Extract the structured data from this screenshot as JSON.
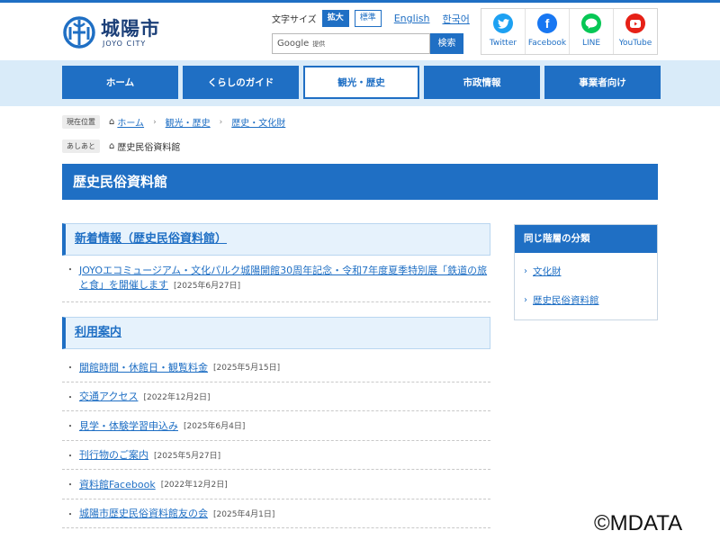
{
  "header": {
    "logo_name": "城陽市",
    "logo_sub": "JOYO CITY",
    "fontsize_label": "文字サイズ",
    "fontsize_large": "拡大",
    "fontsize_normal": "標準",
    "lang_english": "English",
    "lang_korean": "한국어",
    "search_google": "Google",
    "search_provided": "提供",
    "search_button": "検索"
  },
  "social": [
    {
      "label": "Twitter",
      "icon": "twitter-icon",
      "color": "#1da1f2"
    },
    {
      "label": "Facebook",
      "icon": "facebook-icon",
      "color": "#1877f2"
    },
    {
      "label": "LINE",
      "icon": "line-icon",
      "color": "#06c755"
    },
    {
      "label": "YouTube",
      "icon": "youtube-icon",
      "color": "#e62117"
    }
  ],
  "nav": [
    {
      "label": "ホーム"
    },
    {
      "label": "くらしのガイド"
    },
    {
      "label": "観光・歴史"
    },
    {
      "label": "市政情報"
    },
    {
      "label": "事業者向け"
    }
  ],
  "breadcrumb": {
    "current_tag": "現在位置",
    "home": "ホーム",
    "level1": "観光・歴史",
    "level2": "歴史・文化財",
    "footprints_tag": "あしあと",
    "footprint": "歴史民俗資料館"
  },
  "page_title": "歴史民俗資料館",
  "news": {
    "heading": "新着情報（歴史民俗資料館）",
    "items": [
      {
        "title": "JOYOエコミュージアム・文化パルク城陽開館30周年記念・令和7年度夏季特別展「鉄道の旅と食」を開催します",
        "date": "[2025年6月27日]"
      }
    ]
  },
  "guide": {
    "heading": "利用案内",
    "items": [
      {
        "title": "開館時間・休館日・観覧料金",
        "date": "[2025年5月15日]"
      },
      {
        "title": "交通アクセス",
        "date": "[2022年12月2日]"
      },
      {
        "title": "見学・体験学習申込み",
        "date": "[2025年6月4日]"
      },
      {
        "title": "刊行物のご案内",
        "date": "[2025年5月27日]"
      },
      {
        "title": "資料館Facebook",
        "date": "[2022年12月2日]"
      },
      {
        "title": "城陽市歴史民俗資料館友の会",
        "date": "[2025年4月1日]"
      }
    ]
  },
  "sidebar": {
    "heading": "同じ階層の分類",
    "items": [
      {
        "label": "文化財"
      },
      {
        "label": "歴史民俗資料館"
      }
    ]
  },
  "watermark": "©MDATA",
  "colors": {
    "primary": "#1f6fc4",
    "nav_band": "#d9ebf9",
    "section_bg": "#e6f2fc"
  }
}
